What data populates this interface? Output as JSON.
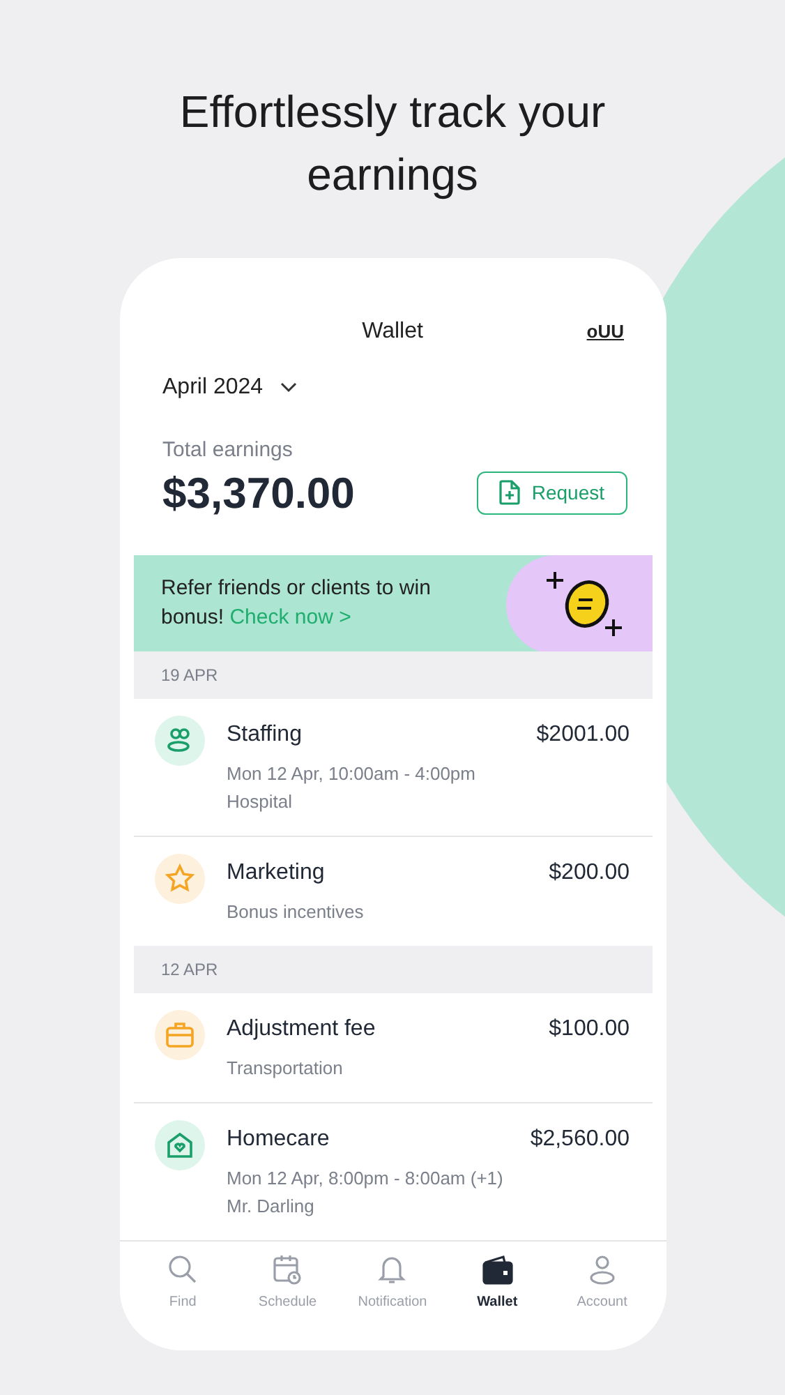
{
  "headline": "Effortlessly track your earnings",
  "header": {
    "title": "Wallet",
    "logo": "oUU"
  },
  "month": "April 2024",
  "total": {
    "label": "Total earnings",
    "amount": "$3,370.00",
    "button": "Request"
  },
  "banner": {
    "text": "Refer friends or clients to win bonus!",
    "link": "Check now >"
  },
  "sections": [
    {
      "date": "19 APR",
      "items": [
        {
          "kind": "people",
          "title": "Staffing",
          "amount": "$2001.00",
          "lines": [
            "Mon 12 Apr, 10:00am - 4:00pm",
            "Hospital"
          ]
        },
        {
          "kind": "star",
          "title": "Marketing",
          "amount": "$200.00",
          "lines": [
            "Bonus incentives"
          ]
        }
      ]
    },
    {
      "date": "12 APR",
      "items": [
        {
          "kind": "briefcase",
          "title": "Adjustment fee",
          "amount": "$100.00",
          "lines": [
            "Transportation"
          ]
        },
        {
          "kind": "house",
          "title": "Homecare",
          "amount": "$2,560.00",
          "lines": [
            "Mon 12 Apr, 8:00pm - 8:00am (+1)",
            "Mr. Darling"
          ]
        }
      ]
    }
  ],
  "nav": [
    {
      "kind": "search",
      "label": "Find",
      "selected": false
    },
    {
      "kind": "calendar",
      "label": "Schedule",
      "selected": false
    },
    {
      "kind": "bell",
      "label": "Notification",
      "selected": false
    },
    {
      "kind": "wallet",
      "label": "Wallet",
      "selected": true
    },
    {
      "kind": "person",
      "label": "Account",
      "selected": false
    }
  ]
}
